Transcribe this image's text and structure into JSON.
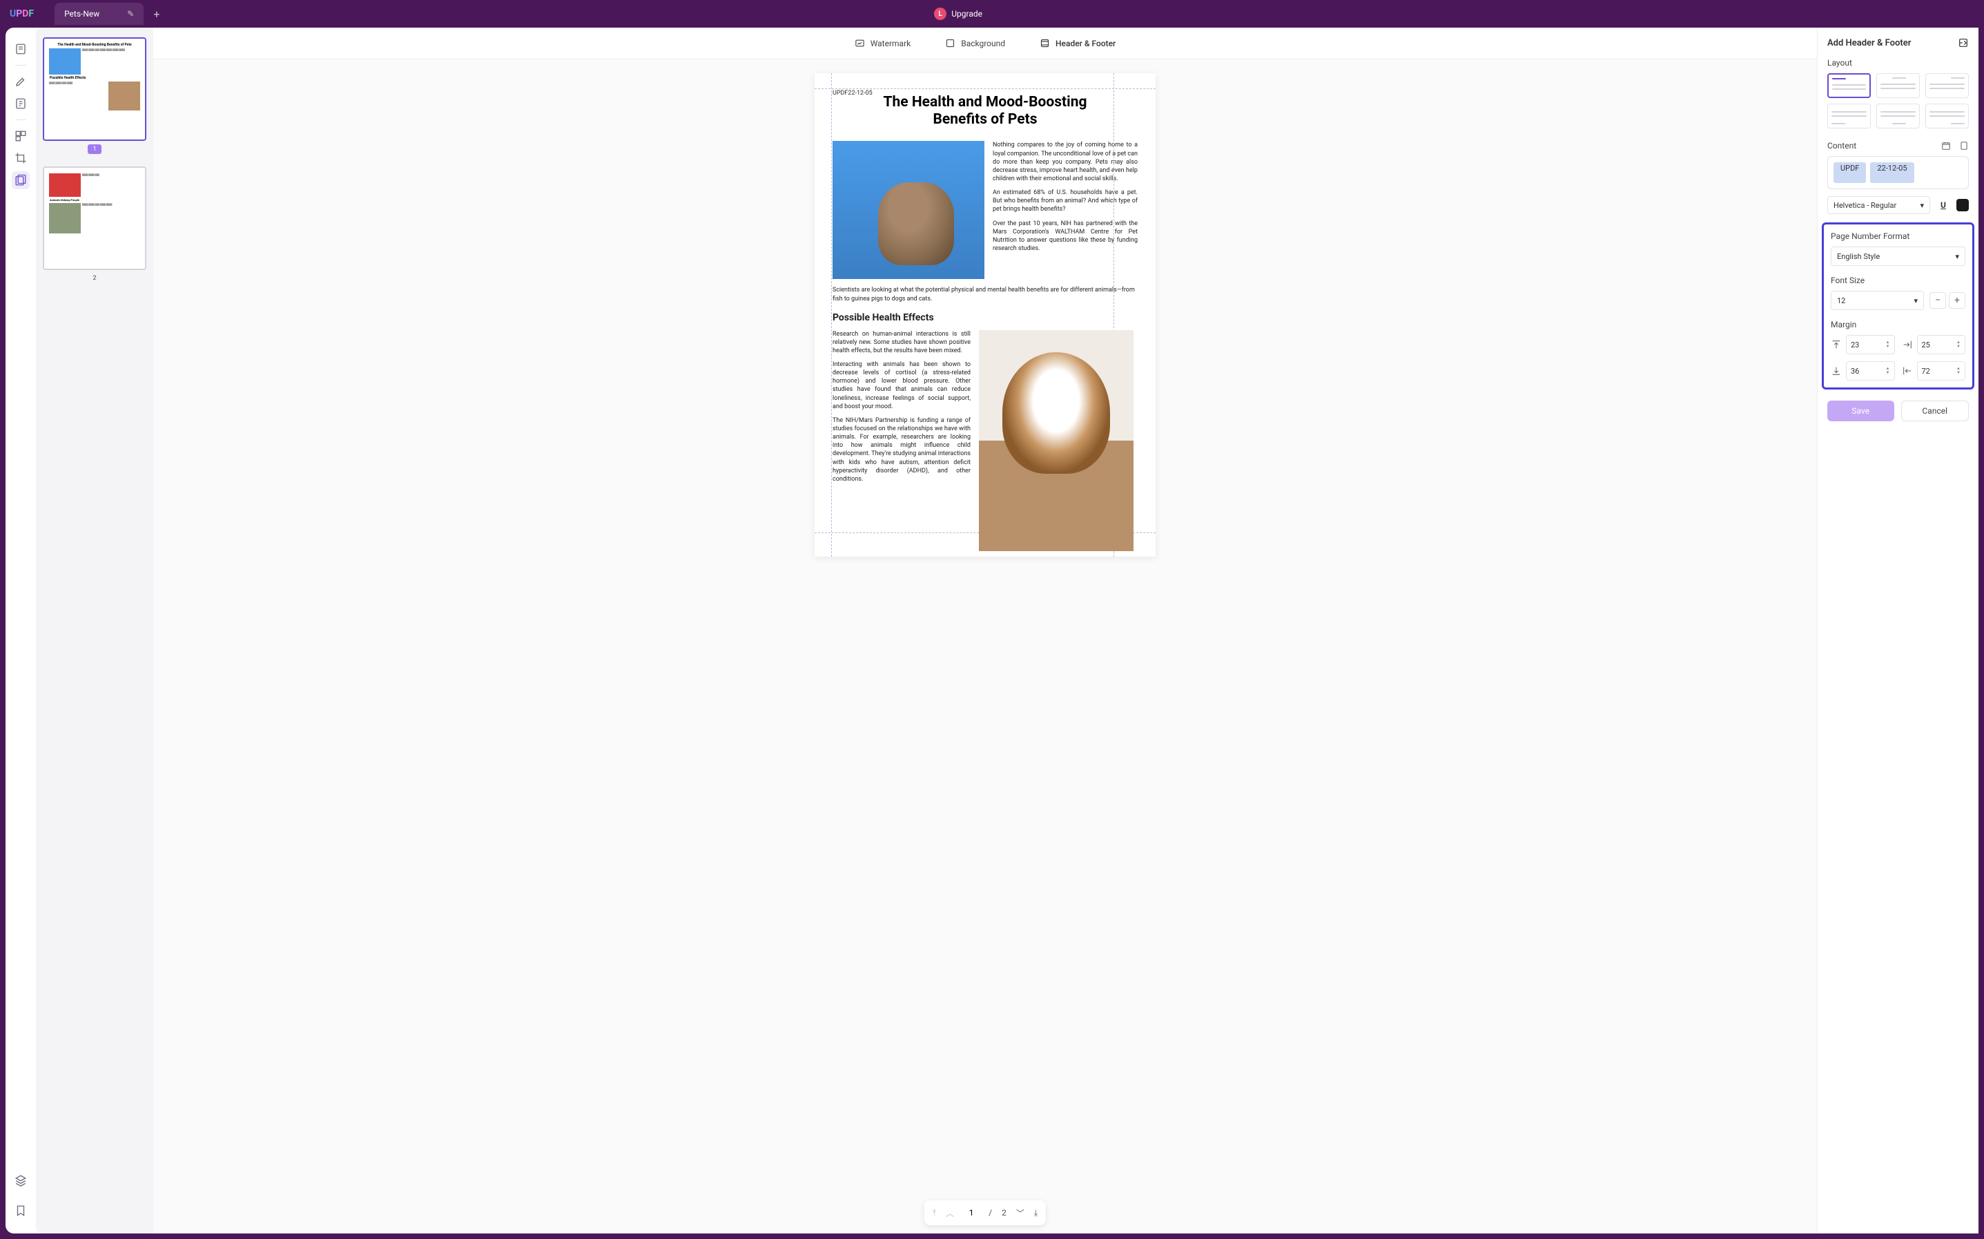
{
  "titlebar": {
    "logo_u": "U",
    "logo_p": "P",
    "logo_d": "D",
    "logo_f": "F",
    "tab_name": "Pets-New",
    "upgrade_initial": "L",
    "upgrade_label": "Upgrade"
  },
  "thumbs": {
    "page1": "1",
    "page2": "2"
  },
  "top_tabs": {
    "watermark": "Watermark",
    "background": "Background",
    "header_footer": "Header & Footer"
  },
  "document": {
    "hf_stamp": "UPDF22-12-05",
    "title": "The Health and Mood-Boosting Benefits of Pets",
    "p1": "Nothing compares to the joy of coming home to a loyal companion. The unconditional love of a pet can do more than keep you company. Pets may also decrease stress, improve heart health, and even help children with their emotional and social skills.",
    "p2": "An estimated 68% of U.S. households have a pet. But who benefits from an animal? And which type of pet brings health benefits?",
    "p3": "Over the past 10 years, NIH has partnered with the Mars Corporation's WALTHAM Centre for Pet Nutrition to answer questions like these by funding research studies.",
    "p4": "Scientists are looking at what the potential physical and mental health benefits are for different animals—from fish to guinea pigs to dogs and cats.",
    "sec": "Possible Health Effects",
    "p5": "Research on human-animal interactions is still relatively new. Some studies have shown positive health effects, but the results have been mixed.",
    "p6": "Interacting with animals has been shown to decrease levels of cortisol (a stress-related hormone) and lower blood pressure. Other studies have found that animals can reduce loneliness, increase feelings of social support, and boost your mood.",
    "p7": "The NIH/Mars Partnership is funding a range of studies focused on the relationships we have with animals. For example, researchers are looking into how animals might influence child development. They're studying animal interactions with kids who have autism, attention deficit hyperactivity disorder (ADHD), and other conditions."
  },
  "pager": {
    "current": "1",
    "sep": "/",
    "total": "2"
  },
  "panel": {
    "title": "Add Header & Footer",
    "layout_label": "Layout",
    "content_label": "Content",
    "chip_updf": "UPDF",
    "chip_date": "22-12-05",
    "font_name": "Helvetica - Regular",
    "underline": "U",
    "pnf_label": "Page Number Format",
    "pnf_value": "English Style",
    "fs_label": "Font Size",
    "fs_value": "12",
    "margin_label": "Margin",
    "m_top": "23",
    "m_right": "25",
    "m_bottom": "36",
    "m_left": "72",
    "save": "Save",
    "cancel": "Cancel"
  }
}
